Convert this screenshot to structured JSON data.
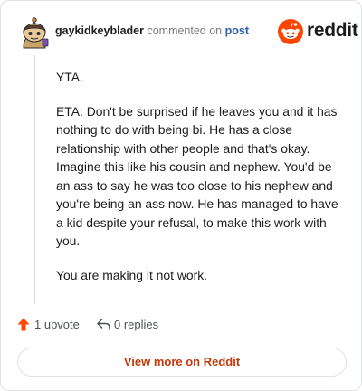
{
  "header": {
    "username": "gaykidkeyblader",
    "action": "commented on",
    "post_link": "post"
  },
  "brand": {
    "name": "reddit",
    "accent": "#ff4500"
  },
  "comment": {
    "paragraphs": [
      "YTA.",
      "ETA: Don't be surprised if he leaves you and it has nothing to do with being bi. He has a close relationship with other people and that's okay. Imagine this like his cousin and nephew. You'd be an ass to say he was too close to his nephew and you're being an ass now. He has managed to have a kid despite your refusal, to make this work with you.",
      "You are making it not work."
    ]
  },
  "footer": {
    "upvote_icon": "upvote-arrow-icon",
    "upvotes": "1 upvote",
    "reply_icon": "reply-arrow-icon",
    "replies": "0 replies"
  },
  "cta": {
    "label": "View more on Reddit",
    "color": "#c23b0a"
  }
}
